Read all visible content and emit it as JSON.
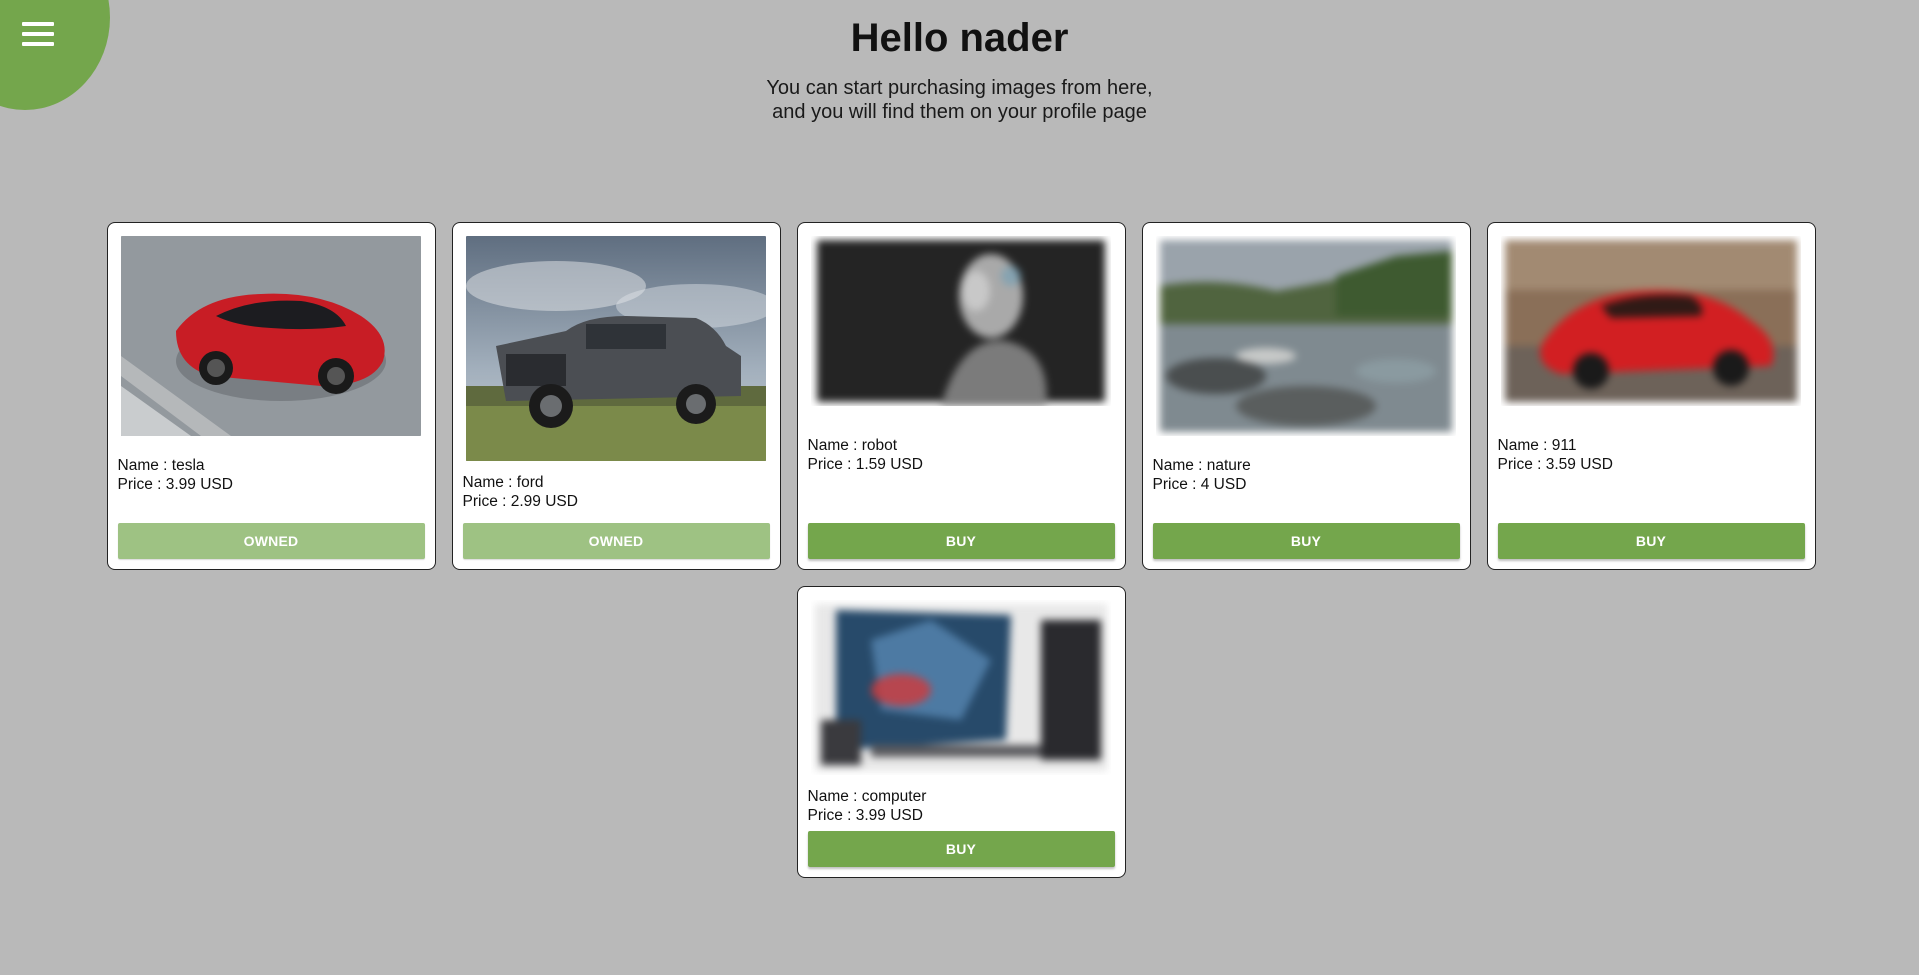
{
  "header": {
    "title": "Hello nader",
    "subtitle_line1": "You can start purchasing images from here,",
    "subtitle_line2": "and you will find them on your profile page"
  },
  "menu": {
    "icon": "hamburger-menu-icon",
    "color": "#74a64c"
  },
  "colors": {
    "background": "#b9b9b9",
    "accent": "#74a64c",
    "owned": "#9ec283"
  },
  "products": [
    {
      "name_text": "Name : tesla",
      "price_text": "Price : 3.99 USD",
      "button_label": "OWNED",
      "owned": true,
      "image": "red-sports-car-photo"
    },
    {
      "name_text": "Name : ford",
      "price_text": "Price : 2.99 USD",
      "button_label": "OWNED",
      "owned": true,
      "image": "pickup-truck-photo"
    },
    {
      "name_text": "Name : robot",
      "price_text": "Price : 1.59 USD",
      "button_label": "BUY",
      "owned": false,
      "image": "robot-photo-blurred"
    },
    {
      "name_text": "Name : nature",
      "price_text": "Price : 4 USD",
      "button_label": "BUY",
      "owned": false,
      "image": "river-landscape-photo-blurred"
    },
    {
      "name_text": "Name : 911",
      "price_text": "Price : 3.59 USD",
      "button_label": "BUY",
      "owned": false,
      "image": "red-coupe-photo-blurred"
    },
    {
      "name_text": "Name : computer",
      "price_text": "Price : 3.99 USD",
      "button_label": "BUY",
      "owned": false,
      "image": "computer-setup-photo-blurred"
    }
  ]
}
